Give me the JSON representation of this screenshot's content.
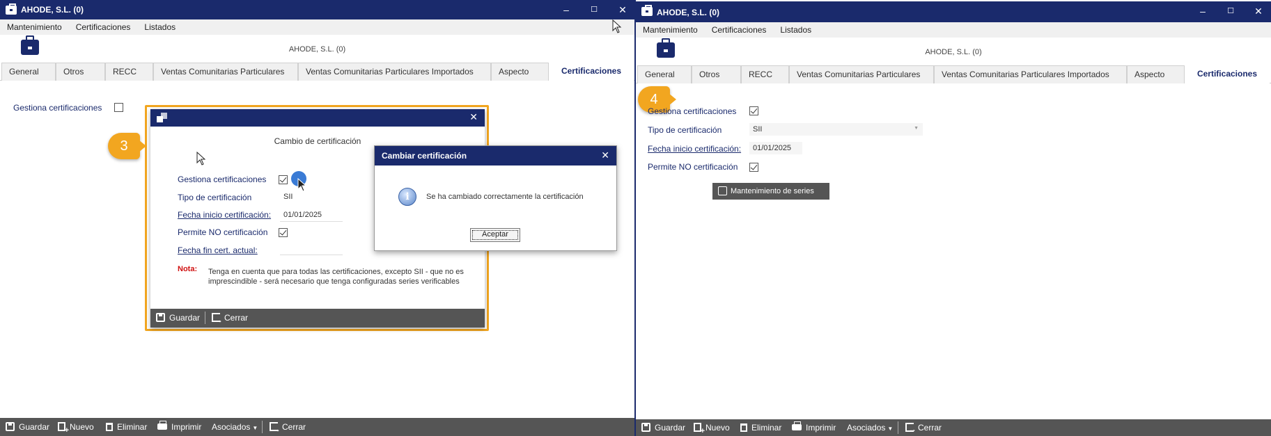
{
  "window_left": {
    "title": "AHODE, S.L. (0)",
    "menu": [
      "Mantenimiento",
      "Certificaciones",
      "Listados"
    ],
    "header_title": "AHODE, S.L. (0)",
    "tabs": [
      "General",
      "Otros",
      "RECC",
      "Ventas Comunitarias Particulares",
      "Ventas Comunitarias Particulares Importados",
      "Aspecto",
      "Certificaciones"
    ],
    "active_tab": "Certificaciones",
    "gestiona_label": "Gestiona certificaciones",
    "gestiona_checked": false,
    "bottom": {
      "guardar": "Guardar",
      "nuevo": "Nuevo",
      "eliminar": "Eliminar",
      "imprimir": "Imprimir",
      "asociados": "Asociados",
      "cerrar": "Cerrar"
    },
    "badge": "3"
  },
  "dialog_cambio": {
    "heading": "Cambio de certificación",
    "gestiona_label": "Gestiona certificaciones",
    "gestiona_checked": true,
    "tipo_label": "Tipo de certificación",
    "tipo_value": "SII",
    "fecha_inicio_label": "Fecha inicio certificación:",
    "fecha_inicio_value": "01/01/2025",
    "permite_label": "Permite NO certificación",
    "permite_checked": true,
    "fecha_fin_label": "Fecha fin cert. actual:",
    "nota_label": "Nota:",
    "nota_text": "Tenga en cuenta que para todas las certificaciones, excepto SII - que no es imprescindible - será necesario que tenga configuradas series verificables",
    "guardar": "Guardar",
    "cerrar": "Cerrar"
  },
  "msgbox": {
    "title": "Cambiar certificación",
    "message": "Se ha cambiado correctamente la certificación",
    "button": "Aceptar"
  },
  "window_right": {
    "title": "AHODE, S.L. (0)",
    "menu": [
      "Mantenimiento",
      "Certificaciones",
      "Listados"
    ],
    "header_title": "AHODE, S.L. (0)",
    "tabs": [
      "General",
      "Otros",
      "RECC",
      "Ventas Comunitarias Particulares",
      "Ventas Comunitarias Particulares Importados",
      "Aspecto",
      "Certificaciones"
    ],
    "active_tab": "Certificaciones",
    "gestiona_label": "Gestiona certificaciones",
    "gestiona_checked": true,
    "tipo_label": "Tipo de certificación",
    "tipo_value": "SII",
    "fecha_inicio_label": "Fecha inicio certificación:",
    "fecha_inicio_value": "01/01/2025",
    "permite_label": "Permite NO certificación",
    "permite_checked": true,
    "series_button": "Mantenimiento de series",
    "bottom": {
      "guardar": "Guardar",
      "nuevo": "Nuevo",
      "eliminar": "Eliminar",
      "imprimir": "Imprimir",
      "asociados": "Asociados",
      "cerrar": "Cerrar"
    },
    "badge": "4"
  },
  "colors": {
    "title_bar": "#1a2a6c",
    "highlight": "#f2a620",
    "bottom_bar": "#555555",
    "note_red": "#d01010"
  }
}
